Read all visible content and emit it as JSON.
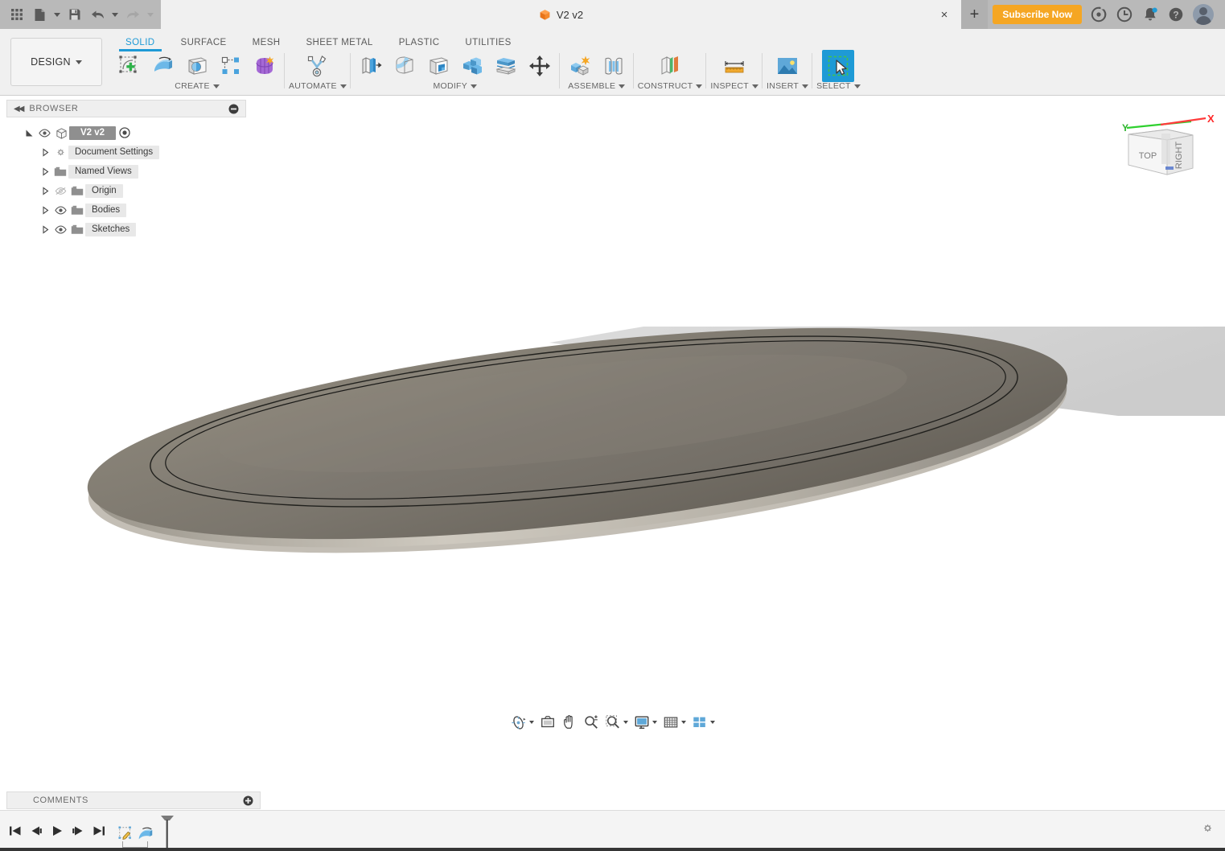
{
  "app": {
    "title": "Fusion 360",
    "brand_accent": "#1e9ad6",
    "subscribe_accent": "#f5a623",
    "titlebar_bg": "#b9b9b9",
    "ribbon_bg": "#f0f0f0"
  },
  "quick_access": {
    "items": [
      {
        "name": "app-grid-icon",
        "label": "Show Data Panel"
      },
      {
        "name": "file-icon",
        "label": "File"
      },
      {
        "name": "save-icon",
        "label": "Save"
      },
      {
        "name": "undo-icon",
        "label": "Undo"
      },
      {
        "name": "redo-icon",
        "label": "Redo"
      }
    ]
  },
  "tabs": {
    "documents": [
      {
        "label": "V2 v2",
        "icon": "orange-cube-icon",
        "active": true
      }
    ],
    "close_label": "×",
    "add_label": "+"
  },
  "titlebar_right": {
    "subscribe_label": "Subscribe Now",
    "icons": [
      {
        "name": "extensions-icon",
        "label": "Extensions"
      },
      {
        "name": "job-status-icon",
        "label": "Job Status"
      },
      {
        "name": "notifications-icon",
        "label": "Notifications"
      },
      {
        "name": "help-icon",
        "label": "Help"
      }
    ],
    "avatar_label": "Account"
  },
  "ribbon": {
    "design_dropdown": "DESIGN",
    "workspace_tabs": [
      {
        "label": "SOLID",
        "active": true
      },
      {
        "label": "SURFACE",
        "active": false
      },
      {
        "label": "MESH",
        "active": false
      },
      {
        "label": "SHEET METAL",
        "active": false
      },
      {
        "label": "PLASTIC",
        "active": false
      },
      {
        "label": "UTILITIES",
        "active": false
      }
    ],
    "panels": [
      {
        "label": "CREATE",
        "has_caret": true,
        "tools": [
          {
            "name": "create-sketch-icon",
            "label": "Create Sketch",
            "selected": false
          },
          {
            "name": "extrude-icon",
            "label": "Extrude",
            "selected": false
          },
          {
            "name": "revolve-icon",
            "label": "Revolve",
            "selected": false
          },
          {
            "name": "pattern-icon",
            "label": "Pattern",
            "selected": false
          },
          {
            "name": "form-icon",
            "label": "Create Form",
            "selected": false
          }
        ]
      },
      {
        "label": "AUTOMATE",
        "has_caret": true,
        "tools": [
          {
            "name": "automate-icon",
            "label": "Automate",
            "selected": false
          }
        ]
      },
      {
        "label": "MODIFY",
        "has_caret": true,
        "tools": [
          {
            "name": "press-pull-icon",
            "label": "Press Pull",
            "selected": false
          },
          {
            "name": "fillet-icon",
            "label": "Fillet",
            "selected": false
          },
          {
            "name": "shell-icon",
            "label": "Shell",
            "selected": false
          },
          {
            "name": "combine-icon",
            "label": "Combine",
            "selected": false
          },
          {
            "name": "split-body-icon",
            "label": "Split Body",
            "selected": false
          },
          {
            "name": "move-copy-icon",
            "label": "Move/Copy",
            "selected": false
          }
        ]
      },
      {
        "label": "ASSEMBLE",
        "has_caret": true,
        "tools": [
          {
            "name": "new-component-icon",
            "label": "New Component",
            "selected": false
          },
          {
            "name": "joint-icon",
            "label": "Joint",
            "selected": false
          }
        ]
      },
      {
        "label": "CONSTRUCT",
        "has_caret": true,
        "tools": [
          {
            "name": "construct-plane-icon",
            "label": "Offset Plane",
            "selected": false
          }
        ]
      },
      {
        "label": "INSPECT",
        "has_caret": true,
        "tools": [
          {
            "name": "measure-icon",
            "label": "Measure",
            "selected": false
          }
        ]
      },
      {
        "label": "INSERT",
        "has_caret": true,
        "tools": [
          {
            "name": "insert-image-icon",
            "label": "Insert Image",
            "selected": false
          }
        ]
      },
      {
        "label": "SELECT",
        "has_caret": true,
        "tools": [
          {
            "name": "select-cursor-icon",
            "label": "Select",
            "selected": true
          }
        ]
      }
    ]
  },
  "browser": {
    "header": "BROWSER",
    "collapse_label": "◀◀",
    "minimize_label": "−",
    "tree": [
      {
        "label": "V2 v2",
        "depth": 0,
        "root": true,
        "twisty": "expanded",
        "visible": true,
        "icon": "component-cube-icon",
        "has_target": true
      },
      {
        "label": "Document Settings",
        "depth": 1,
        "root": false,
        "twisty": "collapsed",
        "visible": null,
        "icon": "gear-icon",
        "has_target": false
      },
      {
        "label": "Named Views",
        "depth": 1,
        "root": false,
        "twisty": "collapsed",
        "visible": null,
        "icon": "folder-icon",
        "has_target": false
      },
      {
        "label": "Origin",
        "depth": 1,
        "root": false,
        "twisty": "collapsed",
        "visible": false,
        "icon": "folder-icon",
        "has_target": false
      },
      {
        "label": "Bodies",
        "depth": 1,
        "root": false,
        "twisty": "collapsed",
        "visible": true,
        "icon": "folder-icon",
        "has_target": false
      },
      {
        "label": "Sketches",
        "depth": 1,
        "root": false,
        "twisty": "collapsed",
        "visible": true,
        "icon": "folder-icon",
        "has_target": false
      }
    ]
  },
  "viewcube": {
    "front_face": "TOP",
    "side_face": "RIGHT",
    "axis_x": "X",
    "axis_y": "Y",
    "axis_x_color": "#ff2a2a",
    "axis_y_color": "#22cc22"
  },
  "canvas": {
    "background": "#ffffff",
    "model_description": "Shaded elliptical dish / lens body, dark grey-brown, with offset sketch edge lines near the rim and a light grey construction plane extending to the upper right",
    "model_color": "#7a7469",
    "plane_color": "#d2d2d2"
  },
  "navbar": {
    "items": [
      {
        "name": "orbit-icon",
        "label": "Orbit",
        "caret": true
      },
      {
        "name": "look-at-icon",
        "label": "Look At",
        "caret": false
      },
      {
        "name": "pan-icon",
        "label": "Pan",
        "caret": false
      },
      {
        "name": "zoom-icon",
        "label": "Zoom",
        "caret": false
      },
      {
        "name": "zoom-window-icon",
        "label": "Fit",
        "caret": true
      },
      {
        "name": "display-settings-icon",
        "label": "Display Settings",
        "caret": true
      },
      {
        "name": "grid-snaps-icon",
        "label": "Grid and Snaps",
        "caret": true
      },
      {
        "name": "viewport-layout-icon",
        "label": "Viewports",
        "caret": true
      }
    ]
  },
  "comments": {
    "header": "COMMENTS",
    "add_label": "+"
  },
  "timeline": {
    "controls": [
      {
        "name": "go-to-beginning-icon",
        "label": "Go to Beginning"
      },
      {
        "name": "step-back-icon",
        "label": "Step Back"
      },
      {
        "name": "play-icon",
        "label": "Play"
      },
      {
        "name": "step-forward-icon",
        "label": "Step Forward"
      },
      {
        "name": "go-to-end-icon",
        "label": "Go to End"
      }
    ],
    "features": [
      {
        "name": "timeline-sketch-icon",
        "label": "Sketch"
      },
      {
        "name": "timeline-extrude-icon",
        "label": "Extrude"
      }
    ],
    "marker_label": "Timeline Marker"
  },
  "statusbar": {
    "settings_label": "Settings"
  }
}
